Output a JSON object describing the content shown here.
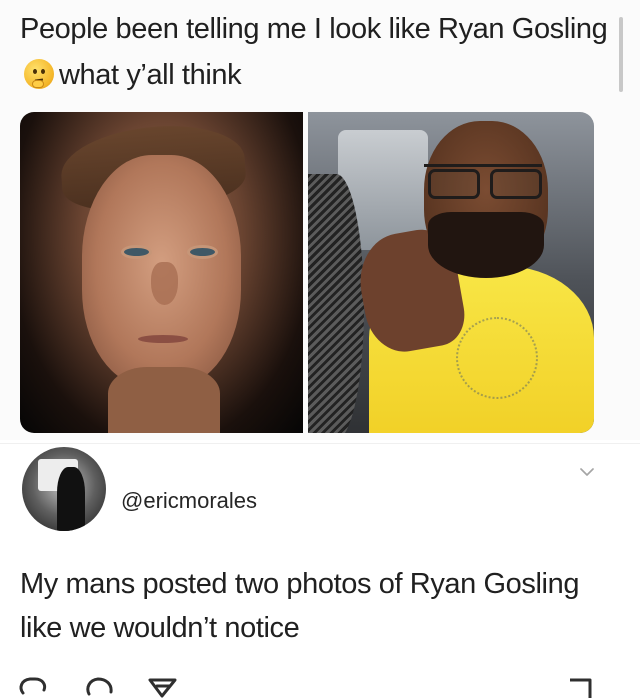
{
  "post": {
    "text_before_emoji": "People been telling me I look like Ryan Gosling",
    "emoji": "thinking-face-emoji",
    "text_after_emoji": "what y’all think"
  },
  "reply": {
    "username": "@ericmorales",
    "text": "My mans posted two photos of Ryan Gosling like we wouldn’t notice"
  },
  "icons": {
    "expand": "chevron-down-icon",
    "comment": "comment-icon",
    "retweet": "retweet-icon",
    "share": "share-icon",
    "save": "bookmark-icon"
  },
  "colors": {
    "background": "#ffffff",
    "text": "#202020",
    "muted_icon": "#a5a5a5",
    "shirt": "#f8e646"
  }
}
